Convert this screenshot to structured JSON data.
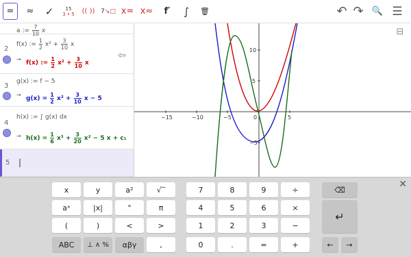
{
  "toolbar": {
    "equals": "=",
    "approx": "≈",
    "check": "✓",
    "fraction_top": "15",
    "fraction_bottom": "3 • 5",
    "paren": "(( ))",
    "seven": "7",
    "xeq": "x=",
    "xapprox": "x≈",
    "fprime": "f′",
    "integral": "∫",
    "trash": "🗑",
    "undo": "↶",
    "redo": "↷",
    "search": "🔍",
    "menu": "☰"
  },
  "algebra": {
    "toggle_icon": "⇦",
    "rows": [
      {
        "num": "",
        "input": "a := ",
        "frac_num": "7",
        "frac_den": "10",
        "input_tail": " x"
      },
      {
        "num": "2",
        "input": "f(x) := ",
        "input_frac1_num": "1",
        "input_frac1_den": "2",
        "input_mid": " x² + ",
        "input_frac2_num": "3",
        "input_frac2_den": "10",
        "input_tail": " x",
        "out_lhs": "f(x) := ",
        "out_frac1_num": "1",
        "out_frac1_den": "2",
        "out_mid": " x² + ",
        "out_frac2_num": "3",
        "out_frac2_den": "10",
        "out_tail": " x",
        "color": "#cc0000"
      },
      {
        "num": "3",
        "input": "g(x) := f − 5",
        "out_lhs": "g(x) = ",
        "out_frac1_num": "1",
        "out_frac1_den": "2",
        "out_mid": " x² + ",
        "out_frac2_num": "3",
        "out_frac2_den": "10",
        "out_tail": " x − 5",
        "color": "#1a1acc"
      },
      {
        "num": "4",
        "input": "h(x) := ∫ g(x) dx",
        "out_lhs": "h(x) = ",
        "out_frac1_num": "1",
        "out_frac1_den": "6",
        "out_mid": " x³ + ",
        "out_frac2_num": "3",
        "out_frac2_den": "20",
        "out_tail": " x² − 5 x + c₁",
        "color": "#1a6b1a"
      },
      {
        "num": "5",
        "input": "|"
      }
    ]
  },
  "graph": {
    "x_ticks": [
      "−15",
      "−10",
      "−5",
      "0",
      "5"
    ],
    "y_ticks": [
      "10",
      "5",
      "−5"
    ],
    "style_icon": "⊟"
  },
  "keyboard": {
    "close": "✕",
    "row1": [
      "x",
      "y",
      "a²",
      "√‾",
      "7",
      "8",
      "9",
      "÷",
      "⌫"
    ],
    "row2": [
      "aˣ",
      "|x|",
      "°",
      "π",
      "4",
      "5",
      "6",
      "×",
      "↵"
    ],
    "row3": [
      "(",
      ")",
      "<",
      ">",
      "1",
      "2",
      "3",
      "−"
    ],
    "row4": [
      "ABC",
      "⊥ ∧ %",
      "αβγ",
      ",",
      "0",
      ".",
      "=",
      "+",
      "←",
      "→"
    ]
  }
}
